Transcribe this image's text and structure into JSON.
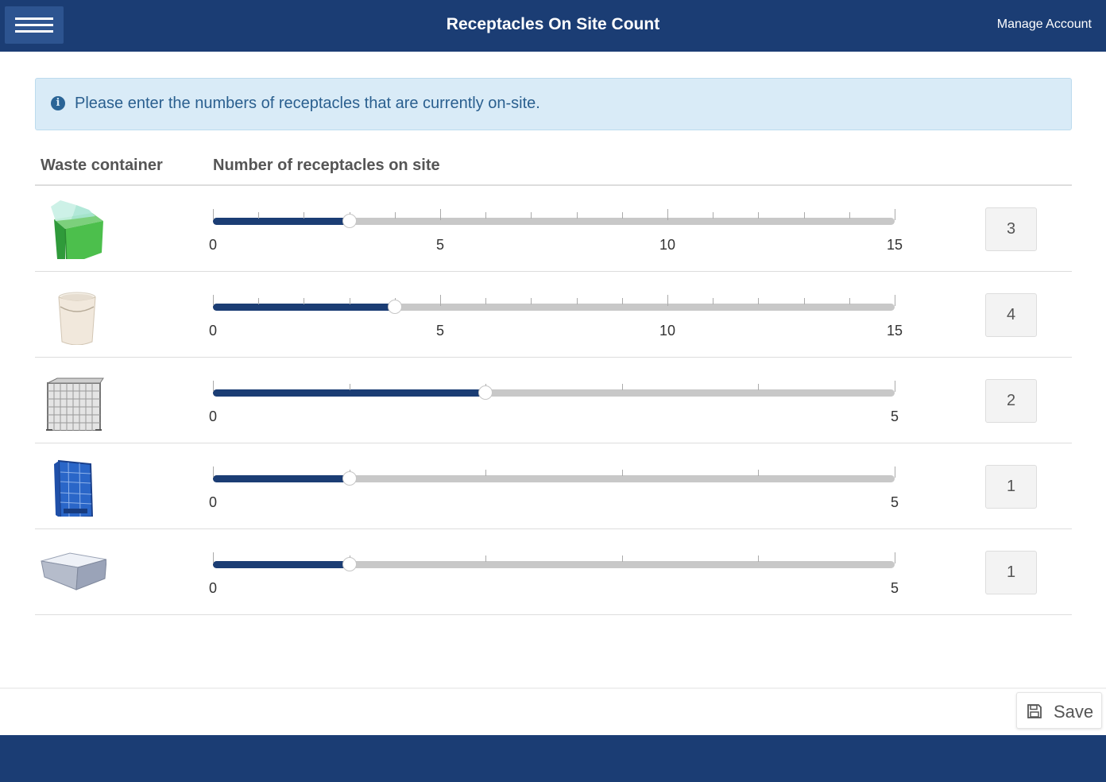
{
  "header": {
    "title": "Receptacles On Site Count",
    "manage_account": "Manage Account",
    "menu_icon": "hamburger-menu-icon",
    "bg_color": "#1b3d74"
  },
  "alert": {
    "icon": "info-icon",
    "text": "Please enter the numbers of receptacles that are currently on-site."
  },
  "table": {
    "col_container": "Waste container",
    "col_count": "Number of receptacles on site"
  },
  "rows": [
    {
      "container": "green-box-bin",
      "value": 3,
      "display": "3",
      "min": 0,
      "max": 15,
      "major_labels": [
        "0",
        "5",
        "10",
        "15"
      ]
    },
    {
      "container": "white-bucket",
      "value": 4,
      "display": "4",
      "min": 0,
      "max": 15,
      "major_labels": [
        "0",
        "5",
        "10",
        "15"
      ]
    },
    {
      "container": "wire-mesh-cage",
      "value": 2,
      "display": "2",
      "min": 0,
      "max": 5,
      "major_labels": [
        "0",
        "5"
      ]
    },
    {
      "container": "blue-cage-bin",
      "value": 1,
      "display": "1",
      "min": 0,
      "max": 5,
      "major_labels": [
        "0",
        "5"
      ]
    },
    {
      "container": "grey-lidded-tub",
      "value": 1,
      "display": "1",
      "min": 0,
      "max": 5,
      "major_labels": [
        "0",
        "5"
      ]
    }
  ],
  "footer": {
    "save_label": "Save",
    "save_icon": "floppy-disk-icon"
  }
}
